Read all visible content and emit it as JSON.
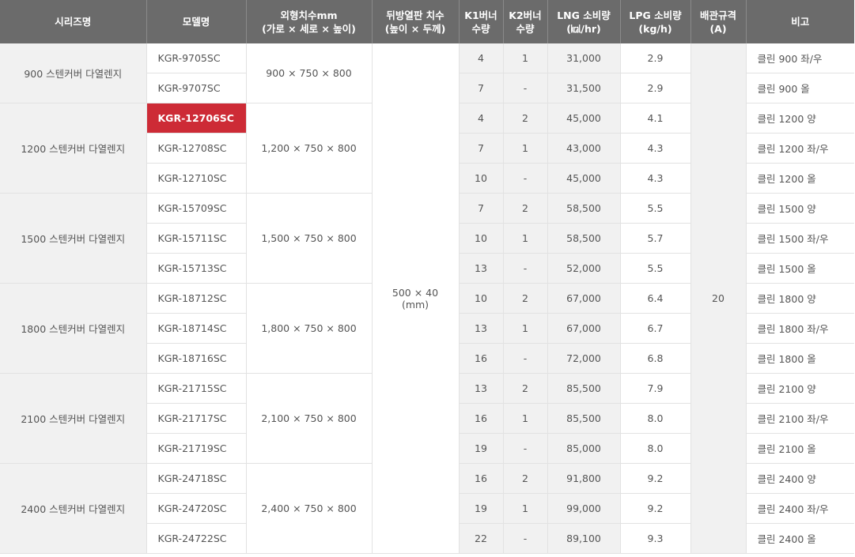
{
  "headers": {
    "series": "시리즈명",
    "model": "모델명",
    "dims_line1": "외형치수mm",
    "dims_line2": "(가로 × 세로 × 높이)",
    "back_line1": "뒤방열판 치수",
    "back_line2": "(높이 × 두께)",
    "k1_line1": "K1버너",
    "k1_line2": "수량",
    "k2_line1": "K2버너",
    "k2_line2": "수량",
    "lng_line1": "LNG 소비량",
    "lng_line2": "(㎉/hr)",
    "lpg_line1": "LPG 소비량",
    "lpg_line2": "(kg/h)",
    "pipe_line1": "배관규격",
    "pipe_line2": "(A)",
    "note": "비고"
  },
  "shared": {
    "back_line1": "500 × 40",
    "back_line2": "(mm)",
    "pipe": "20"
  },
  "groups": [
    {
      "series": "900 스텐커버 다열렌지",
      "dims": "900 × 750 × 800",
      "rows": [
        {
          "model": "KGR-9705SC",
          "k1": "4",
          "k2": "1",
          "lng": "31,000",
          "lpg": "2.9",
          "note": "클린 900 좌/우"
        },
        {
          "model": "KGR-9707SC",
          "k1": "7",
          "k2": "-",
          "lng": "31,500",
          "lpg": "2.9",
          "note": "클린 900 올"
        }
      ]
    },
    {
      "series": "1200 스텐커버 다열렌지",
      "dims": "1,200 × 750 × 800",
      "rows": [
        {
          "model": "KGR-12706SC",
          "k1": "4",
          "k2": "2",
          "lng": "45,000",
          "lpg": "4.1",
          "note": "클린 1200 양",
          "highlight": true
        },
        {
          "model": "KGR-12708SC",
          "k1": "7",
          "k2": "1",
          "lng": "43,000",
          "lpg": "4.3",
          "note": "클린 1200 좌/우"
        },
        {
          "model": "KGR-12710SC",
          "k1": "10",
          "k2": "-",
          "lng": "45,000",
          "lpg": "4.3",
          "note": "클린 1200 올"
        }
      ]
    },
    {
      "series": "1500 스텐커버 다열렌지",
      "dims": "1,500 × 750 × 800",
      "rows": [
        {
          "model": "KGR-15709SC",
          "k1": "7",
          "k2": "2",
          "lng": "58,500",
          "lpg": "5.5",
          "note": "클린 1500 양"
        },
        {
          "model": "KGR-15711SC",
          "k1": "10",
          "k2": "1",
          "lng": "58,500",
          "lpg": "5.7",
          "note": "클린 1500 좌/우"
        },
        {
          "model": "KGR-15713SC",
          "k1": "13",
          "k2": "-",
          "lng": "52,000",
          "lpg": "5.5",
          "note": "클린 1500 올"
        }
      ]
    },
    {
      "series": "1800 스텐커버 다열렌지",
      "dims": "1,800 × 750 × 800",
      "rows": [
        {
          "model": "KGR-18712SC",
          "k1": "10",
          "k2": "2",
          "lng": "67,000",
          "lpg": "6.4",
          "note": "클린 1800 양"
        },
        {
          "model": "KGR-18714SC",
          "k1": "13",
          "k2": "1",
          "lng": "67,000",
          "lpg": "6.7",
          "note": "클린 1800 좌/우"
        },
        {
          "model": "KGR-18716SC",
          "k1": "16",
          "k2": "-",
          "lng": "72,000",
          "lpg": "6.8",
          "note": "클린 1800 올"
        }
      ]
    },
    {
      "series": "2100 스텐커버 다열렌지",
      "dims": "2,100 × 750 × 800",
      "rows": [
        {
          "model": "KGR-21715SC",
          "k1": "13",
          "k2": "2",
          "lng": "85,500",
          "lpg": "7.9",
          "note": "클린 2100 양"
        },
        {
          "model": "KGR-21717SC",
          "k1": "16",
          "k2": "1",
          "lng": "85,500",
          "lpg": "8.0",
          "note": "클린 2100 좌/우"
        },
        {
          "model": "KGR-21719SC",
          "k1": "19",
          "k2": "-",
          "lng": "85,000",
          "lpg": "8.0",
          "note": "클린 2100 올"
        }
      ]
    },
    {
      "series": "2400 스텐커버 다열렌지",
      "dims": "2,400 × 750 × 800",
      "rows": [
        {
          "model": "KGR-24718SC",
          "k1": "16",
          "k2": "2",
          "lng": "91,800",
          "lpg": "9.2",
          "note": "클린 2400 양"
        },
        {
          "model": "KGR-24720SC",
          "k1": "19",
          "k2": "1",
          "lng": "99,000",
          "lpg": "9.2",
          "note": "클린 2400 좌/우"
        },
        {
          "model": "KGR-24722SC",
          "k1": "22",
          "k2": "-",
          "lng": "89,100",
          "lpg": "9.3",
          "note": "클린 2400 올"
        }
      ]
    }
  ]
}
